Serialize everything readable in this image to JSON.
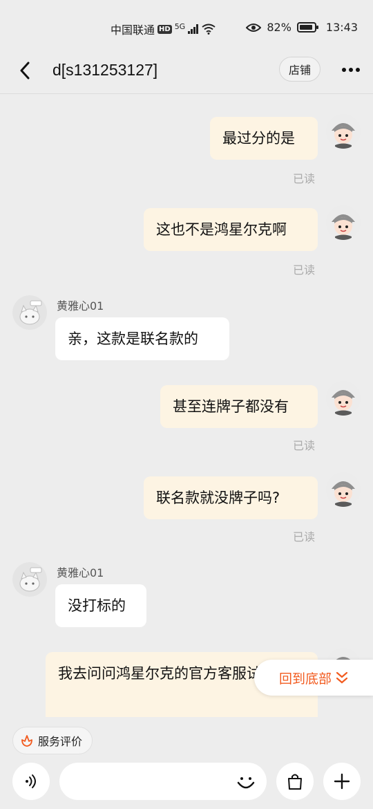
{
  "status_bar": {
    "carrier": "中国联通",
    "hd": "HD",
    "network": "5G",
    "battery": "82%",
    "time": "13:43"
  },
  "header": {
    "title": "d[s131253127]",
    "shop_label": "店铺"
  },
  "chat": {
    "read_label": "已读",
    "other_name": "黄雅心01",
    "messages": [
      {
        "from": "me",
        "text": "最过分的是"
      },
      {
        "from": "me",
        "text": "这也不是鸿星尔克啊"
      },
      {
        "from": "other",
        "text": "亲，这款是联名款的"
      },
      {
        "from": "me",
        "text": "甚至连牌子都没有"
      },
      {
        "from": "me",
        "text": "联名款就没牌子吗?"
      },
      {
        "from": "other",
        "text": "没打标的"
      },
      {
        "from": "me",
        "text": "我去问问鸿星尔克的官方客服试试?"
      }
    ]
  },
  "back_to_bottom_label": "回到底部",
  "bottom": {
    "service_label": "服务评价",
    "input_placeholder": ""
  },
  "colors": {
    "accent": "#f25b1f",
    "my_bubble": "#fdf4e3",
    "other_bubble": "#ffffff",
    "background": "#ededed"
  }
}
